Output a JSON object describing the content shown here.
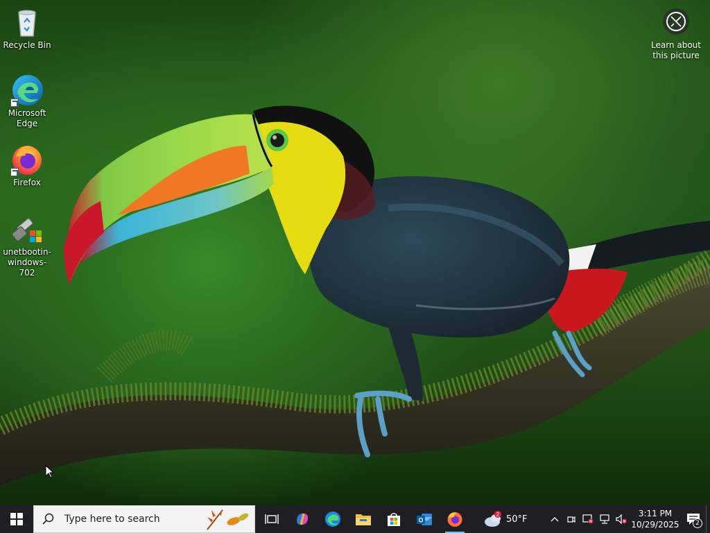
{
  "desktop": {
    "icons": [
      {
        "label": "Recycle Bin",
        "icon": "recycle-bin-icon"
      },
      {
        "label": "Microsoft Edge",
        "icon": "edge-icon"
      },
      {
        "label": "Firefox",
        "icon": "firefox-icon"
      },
      {
        "label": "unetbootin-windows-702",
        "icon": "unetbootin-icon"
      }
    ],
    "learn_about_picture": {
      "label": "Learn about this picture",
      "icon": "camera-icon"
    }
  },
  "taskbar": {
    "search": {
      "placeholder": "Type here to search"
    },
    "apps": [
      {
        "name": "Task View",
        "icon": "task-view-icon"
      },
      {
        "name": "Copilot",
        "icon": "copilot-icon"
      },
      {
        "name": "Microsoft Edge",
        "icon": "edge-icon"
      },
      {
        "name": "File Explorer",
        "icon": "folder-icon"
      },
      {
        "name": "Microsoft Store",
        "icon": "store-icon"
      },
      {
        "name": "Outlook",
        "icon": "outlook-icon"
      },
      {
        "name": "Firefox",
        "icon": "firefox-icon",
        "active": true
      }
    ],
    "weather": {
      "temp": "50°F",
      "badge": "2",
      "icon": "cloud-icon"
    },
    "tray_icons": [
      "chevron-up-icon",
      "meet-now-icon",
      "security-icon",
      "network-icon",
      "volume-muted-icon"
    ],
    "clock": {
      "time": "3:11 PM",
      "date": "10/29/2025"
    },
    "notifications": {
      "count": "2"
    }
  },
  "colors": {
    "taskbar": "#1f1f23",
    "accent": "#76b9ed",
    "edge_blue": "#0c7bd6",
    "firefox_orange": "#ff7139"
  }
}
